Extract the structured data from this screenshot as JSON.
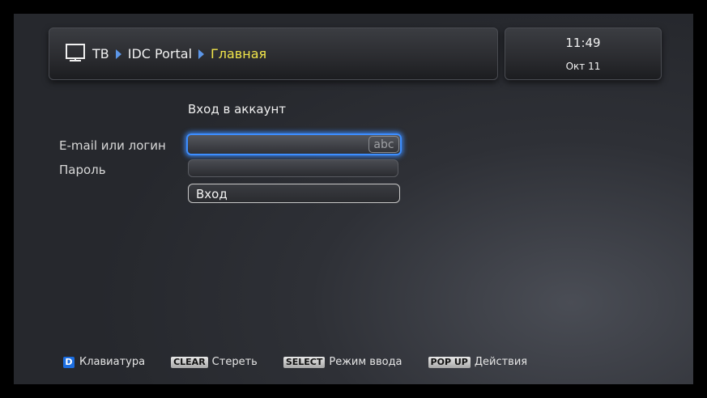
{
  "header": {
    "breadcrumb": [
      "ТВ",
      "IDC Portal",
      "Главная"
    ]
  },
  "clock": {
    "time": "11:49",
    "date": "Окт 11"
  },
  "form": {
    "title": "Вход в аккаунт",
    "email_label": "E-mail или логин",
    "email_value": "",
    "input_mode": "abc",
    "password_label": "Пароль",
    "password_value": "",
    "login_button": "Вход"
  },
  "footer": {
    "hints": [
      {
        "key": "D",
        "label": "Клавиатура"
      },
      {
        "key": "CLEAR",
        "label": "Стереть"
      },
      {
        "key": "SELECT",
        "label": "Режим ввода"
      },
      {
        "key": "POP UP",
        "label": "Действия"
      }
    ]
  },
  "colors": {
    "accent_blue": "#3d8eff",
    "breadcrumb_active": "#f2e64a",
    "key_d_blue": "#1c6ee0"
  }
}
